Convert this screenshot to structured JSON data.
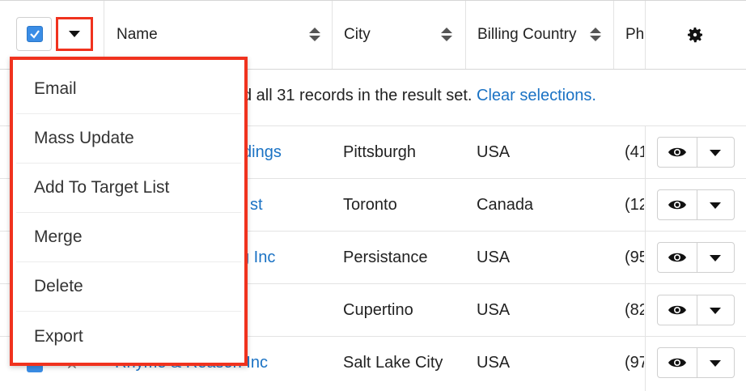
{
  "header": {
    "columns": [
      {
        "label": "Name"
      },
      {
        "label": "City"
      },
      {
        "label": "Billing Country"
      },
      {
        "label": "Ph"
      }
    ]
  },
  "banner": {
    "text": "d all 31 records in the result set.",
    "link": "Clear selections."
  },
  "rows": [
    {
      "name": "dings",
      "city": "Pittsburgh",
      "country": "USA",
      "phone": "(41"
    },
    {
      "name": "st",
      "city": "Toronto",
      "country": "Canada",
      "phone": "(12"
    },
    {
      "name": "g Inc",
      "city": "Persistance",
      "country": "USA",
      "phone": "(95"
    },
    {
      "name": "",
      "city": "Cupertino",
      "country": "USA",
      "phone": "(82"
    },
    {
      "name": "Rhyme & Reason Inc",
      "city": "Salt Lake City",
      "country": "USA",
      "phone": "(97"
    }
  ],
  "menu": {
    "items": [
      {
        "label": "Email"
      },
      {
        "label": "Mass Update"
      },
      {
        "label": "Add To Target List"
      },
      {
        "label": "Merge"
      },
      {
        "label": "Delete"
      },
      {
        "label": "Export"
      }
    ]
  },
  "colors": {
    "accent": "#1a72c4",
    "highlight": "#f0321e",
    "checkbox": "#3a8de6"
  }
}
